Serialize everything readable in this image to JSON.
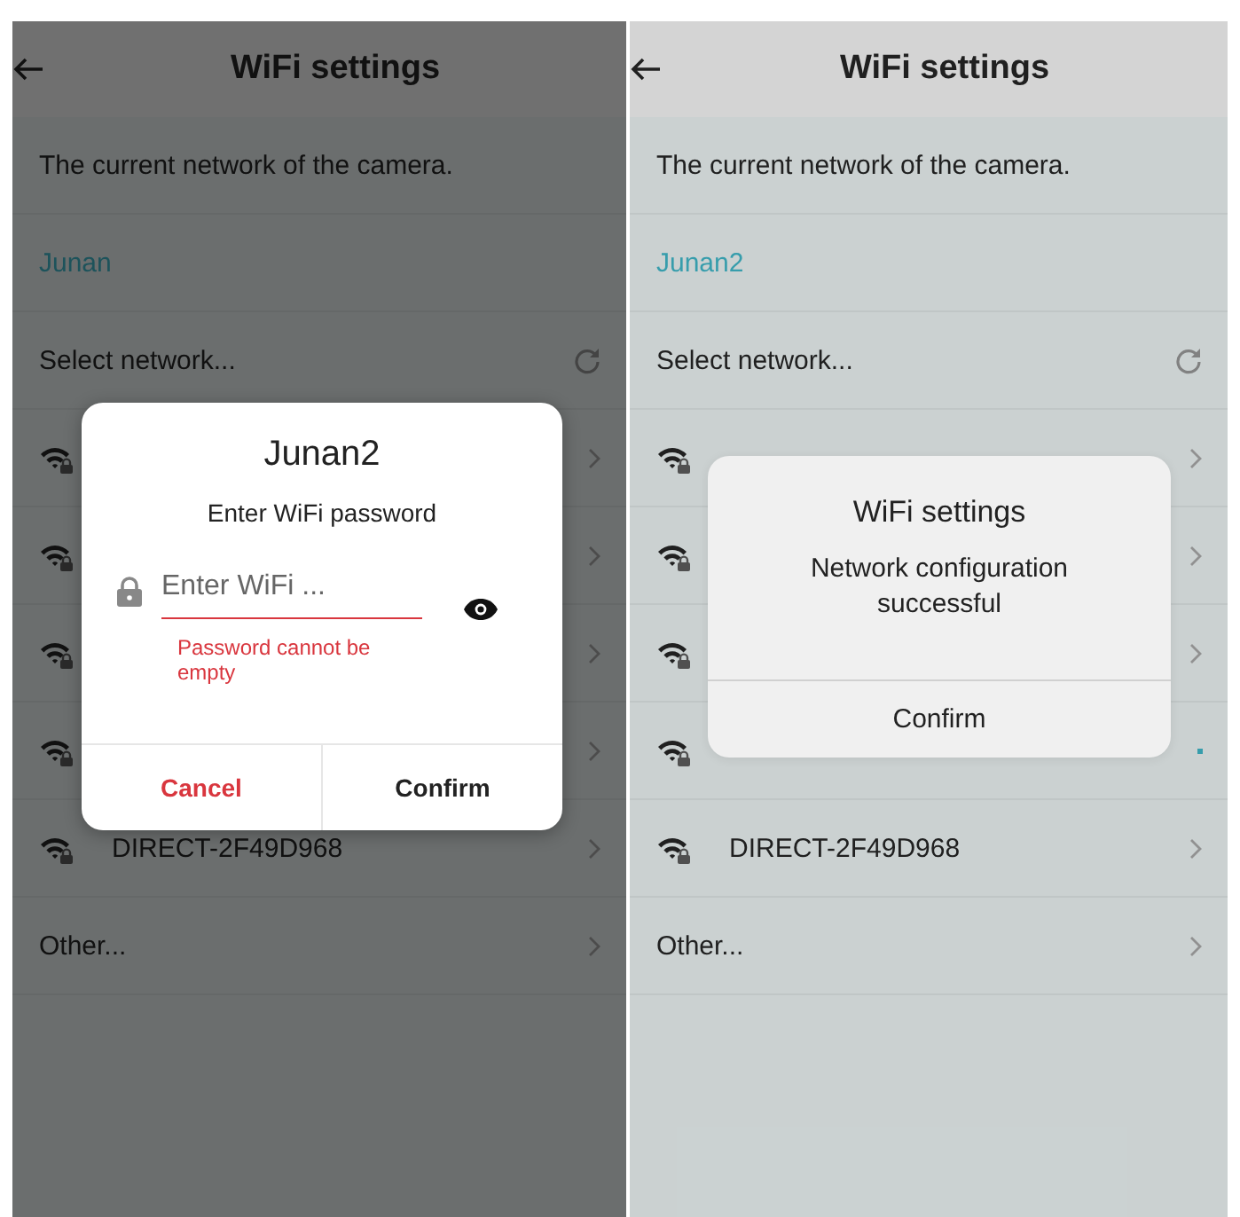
{
  "screens": [
    {
      "header": {
        "title": "WiFi settings"
      },
      "current_label": "The current network of the camera.",
      "current_network": "Junan",
      "select_label": "Select network...",
      "networks": [
        {
          "connected": false
        },
        {
          "connected": false
        },
        {
          "connected": false
        },
        {
          "connected": false
        },
        {
          "name": "DIRECT-2F49D968",
          "connected": false
        }
      ],
      "other": "Other...",
      "dialog": {
        "kind": "password",
        "title": "Junan2",
        "prompt": "Enter WiFi password",
        "placeholder": "Enter WiFi ...",
        "error": "Password cannot be empty",
        "buttons": [
          {
            "label": "Cancel",
            "kind": "cancel"
          },
          {
            "label": "Confirm",
            "kind": "confirm"
          }
        ]
      }
    },
    {
      "header": {
        "title": "WiFi settings"
      },
      "current_label": "The current network of the camera.",
      "current_network": "Junan2",
      "select_label": "Select network...",
      "networks": [
        {
          "connected": false
        },
        {
          "connected": false
        },
        {
          "connected": false
        },
        {
          "connected": true
        },
        {
          "name": "DIRECT-2F49D968",
          "connected": false
        }
      ],
      "other": "Other...",
      "dialog": {
        "kind": "message",
        "title": "WiFi settings",
        "message": "Network configuration successful",
        "buttons": [
          {
            "label": "Confirm",
            "kind": "confirm"
          }
        ]
      }
    }
  ]
}
